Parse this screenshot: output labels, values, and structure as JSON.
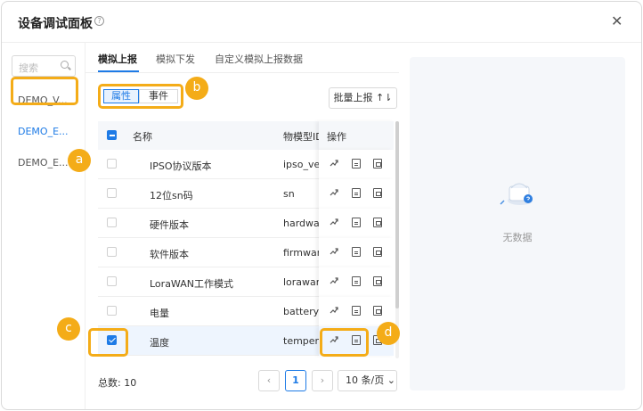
{
  "dialog": {
    "title": "设备调试面板",
    "help_icon": "?",
    "close_icon": "✕"
  },
  "sidebar": {
    "search_placeholder": "搜索",
    "items": [
      {
        "label": "DEMO_V..."
      },
      {
        "label": "DEMO_E...",
        "active": true
      },
      {
        "label": "DEMO_E..."
      }
    ]
  },
  "tabs": [
    {
      "label": "模拟上报",
      "active": true
    },
    {
      "label": "模拟下发"
    },
    {
      "label": "自定义模拟上报数据"
    }
  ],
  "segment": {
    "attr": "属性",
    "event": "事件"
  },
  "batch_button": "批量上报 ↑⇂",
  "table": {
    "columns": {
      "name": "名称",
      "id": "物模型ID",
      "ops": "操作"
    },
    "rows": [
      {
        "name": "IPSO协议版本",
        "id": "ipso_version",
        "checked": false
      },
      {
        "name": "12位sn码",
        "id": "sn",
        "checked": false
      },
      {
        "name": "硬件版本",
        "id": "hardware_version",
        "checked": false
      },
      {
        "name": "软件版本",
        "id": "firmware_version",
        "checked": false
      },
      {
        "name": "LoraWAN工作模式",
        "id": "lorawan_class",
        "checked": false
      },
      {
        "name": "电量",
        "id": "battery",
        "checked": false
      },
      {
        "name": "温度",
        "id": "temperature",
        "checked": true
      }
    ]
  },
  "pagination": {
    "total_label": "总数:  10",
    "prev": "‹",
    "current": "1",
    "next": "›",
    "page_size": "10 条/页 ⌄"
  },
  "empty": {
    "text": "无数据"
  },
  "badges": {
    "a": "a",
    "b": "b",
    "c": "c",
    "d": "d"
  },
  "colors": {
    "accent": "#1e7be6",
    "highlight": "#f4ac18"
  }
}
